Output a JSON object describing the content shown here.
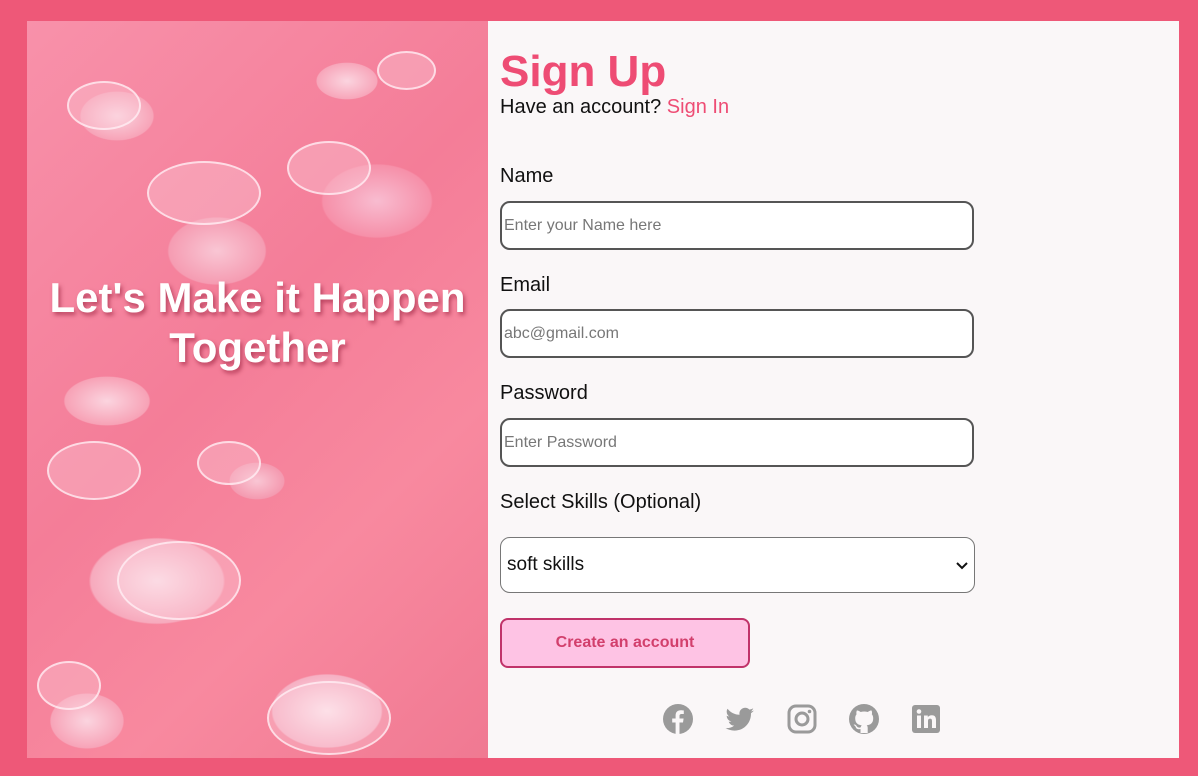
{
  "hero": {
    "title_line1": "Let's Make it Happen",
    "title_line2": "Together"
  },
  "form": {
    "title": "Sign Up",
    "have_account_text": "Have an account?",
    "sign_in_link": "Sign In",
    "name_label": "Name",
    "name_placeholder": "Enter your Name here",
    "email_label": "Email",
    "email_placeholder": "abc@gmail.com",
    "password_label": "Password",
    "password_placeholder": "Enter Password",
    "skills_label": "Select Skills (Optional)",
    "skills_selected": "soft skills",
    "submit_label": "Create an account"
  },
  "socials": [
    {
      "icon": "facebook-icon"
    },
    {
      "icon": "twitter-icon"
    },
    {
      "icon": "instagram-icon"
    },
    {
      "icon": "github-icon"
    },
    {
      "icon": "linkedin-icon"
    }
  ],
  "colors": {
    "background": "#ee5878",
    "accent": "#ee4c74",
    "button_bg": "#fec3e4",
    "social_icon": "#9a9a9a"
  }
}
